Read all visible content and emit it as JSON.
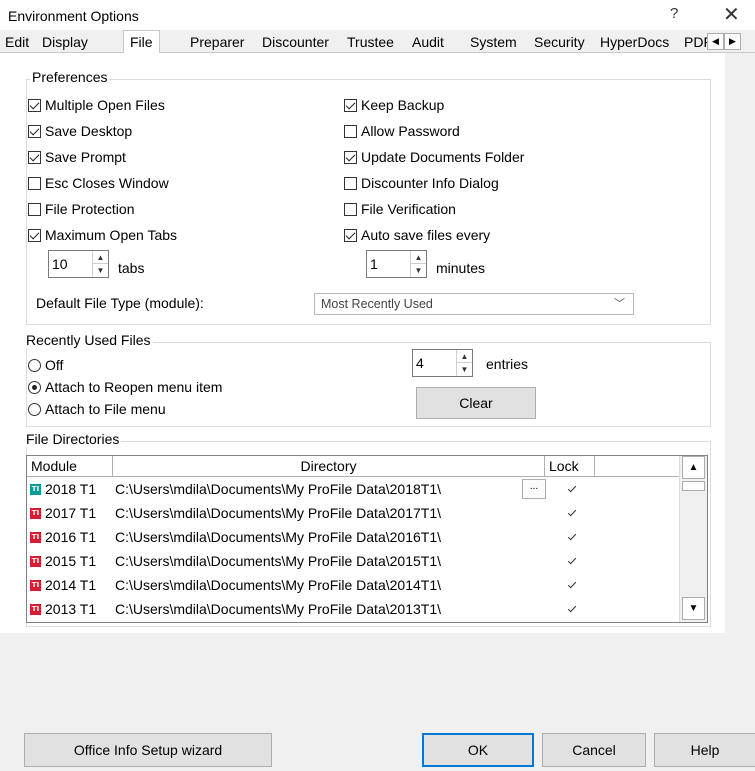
{
  "window": {
    "title": "Environment Options",
    "help_glyph": "?",
    "close_glyph": "✕"
  },
  "tabs": [
    {
      "label": "Edit"
    },
    {
      "label": "Display"
    },
    {
      "label": "File",
      "active": true
    },
    {
      "label": "Preparer"
    },
    {
      "label": "Discounter"
    },
    {
      "label": "Trustee"
    },
    {
      "label": "Audit"
    },
    {
      "label": "System"
    },
    {
      "label": "Security"
    },
    {
      "label": "HyperDocs"
    },
    {
      "label": "PDF"
    }
  ],
  "preferences": {
    "title": "Preferences",
    "left": [
      {
        "label": "Multiple Open Files",
        "checked": true
      },
      {
        "label": "Save Desktop",
        "checked": true
      },
      {
        "label": "Save Prompt",
        "checked": true
      },
      {
        "label": "Esc Closes Window",
        "checked": false
      },
      {
        "label": "File Protection",
        "checked": false
      },
      {
        "label": "Maximum Open Tabs",
        "checked": true
      }
    ],
    "right": [
      {
        "label": "Keep Backup",
        "checked": true
      },
      {
        "label": "Allow Password",
        "checked": false
      },
      {
        "label": "Update Documents Folder",
        "checked": true
      },
      {
        "label": "Discounter Info Dialog",
        "checked": false
      },
      {
        "label": "File Verification",
        "checked": false
      },
      {
        "label": "Auto save files every",
        "checked": true
      }
    ],
    "tabs_value": "10",
    "tabs_unit": "tabs",
    "minutes_value": "1",
    "minutes_unit": "minutes",
    "default_file_type_label": "Default File Type (module):",
    "default_file_type_value": "Most Recently Used"
  },
  "recent": {
    "title": "Recently Used Files",
    "options": [
      {
        "label": "Off",
        "checked": false
      },
      {
        "label": "Attach to Reopen menu item",
        "checked": true
      },
      {
        "label": "Attach to File menu",
        "checked": false
      }
    ],
    "entries_value": "4",
    "entries_unit": "entries",
    "clear_label": "Clear"
  },
  "directories": {
    "title": "File Directories",
    "columns": [
      "Module",
      "Directory",
      "Lock"
    ],
    "rows": [
      {
        "module": "2018 T1",
        "dir": "C:\\Users\\mdila\\Documents\\My ProFile Data\\2018T1\\",
        "locked": true,
        "icon": "teal"
      },
      {
        "module": "2017 T1",
        "dir": "C:\\Users\\mdila\\Documents\\My ProFile Data\\2017T1\\",
        "locked": true,
        "icon": "red"
      },
      {
        "module": "2016 T1",
        "dir": "C:\\Users\\mdila\\Documents\\My ProFile Data\\2016T1\\",
        "locked": true,
        "icon": "red"
      },
      {
        "module": "2015 T1",
        "dir": "C:\\Users\\mdila\\Documents\\My ProFile Data\\2015T1\\",
        "locked": true,
        "icon": "red"
      },
      {
        "module": "2014 T1",
        "dir": "C:\\Users\\mdila\\Documents\\My ProFile Data\\2014T1\\",
        "locked": true,
        "icon": "red"
      },
      {
        "module": "2013 T1",
        "dir": "C:\\Users\\mdila\\Documents\\My ProFile Data\\2013T1\\",
        "locked": true,
        "icon": "red"
      }
    ],
    "browse_label": "..."
  },
  "footer": {
    "wizard_label": "Office Info Setup wizard",
    "ok_label": "OK",
    "cancel_label": "Cancel",
    "help_label": "Help"
  },
  "icon_glyphs": {
    "module_icon_text": "TI",
    "spin_up": "▲",
    "spin_down": "▼",
    "combo_chevron": "﹀",
    "tab_left": "◀",
    "tab_right": "▶",
    "scroll_up": "▲",
    "scroll_down": "▼"
  }
}
